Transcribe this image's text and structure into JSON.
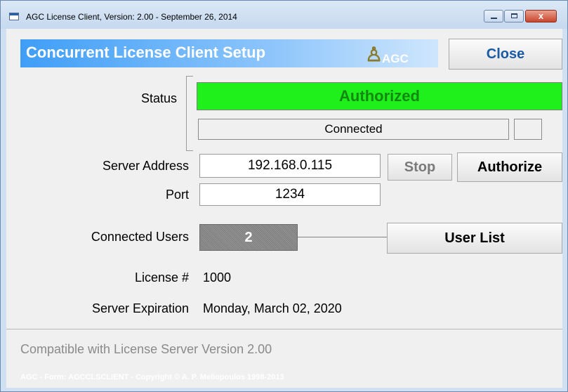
{
  "window": {
    "title": "AGC License Client, Version: 2.00 - September 26, 2014",
    "controls": {
      "minimize": "minimize-icon",
      "maximize": "maximize-icon",
      "close": "close-icon",
      "close_glyph": "x"
    }
  },
  "header": {
    "title": "Concurrent License Client Setup",
    "logo_text": "AGC",
    "close_label": "Close"
  },
  "status": {
    "label": "Status",
    "state": "Authorized",
    "connection": "Connected",
    "colors": {
      "authorized_bg": "#1fef1a",
      "authorized_text": "#128a12"
    }
  },
  "server": {
    "address_label": "Server Address",
    "address": "192.168.0.115",
    "port_label": "Port",
    "port": "1234",
    "stop_label": "Stop",
    "authorize_label": "Authorize"
  },
  "users": {
    "label": "Connected Users",
    "count": "2",
    "list_label": "User List"
  },
  "license": {
    "number_label": "License #",
    "number": "1000",
    "expiration_label": "Server Expiration",
    "expiration": "Monday, March 02, 2020"
  },
  "footer": {
    "compatibility": "Compatible with License Server Version 2.00",
    "copyright": "AGC - Form: AGCCLSCLIENT - Copyright © A. P. Meliopoulos 1998-2013"
  }
}
